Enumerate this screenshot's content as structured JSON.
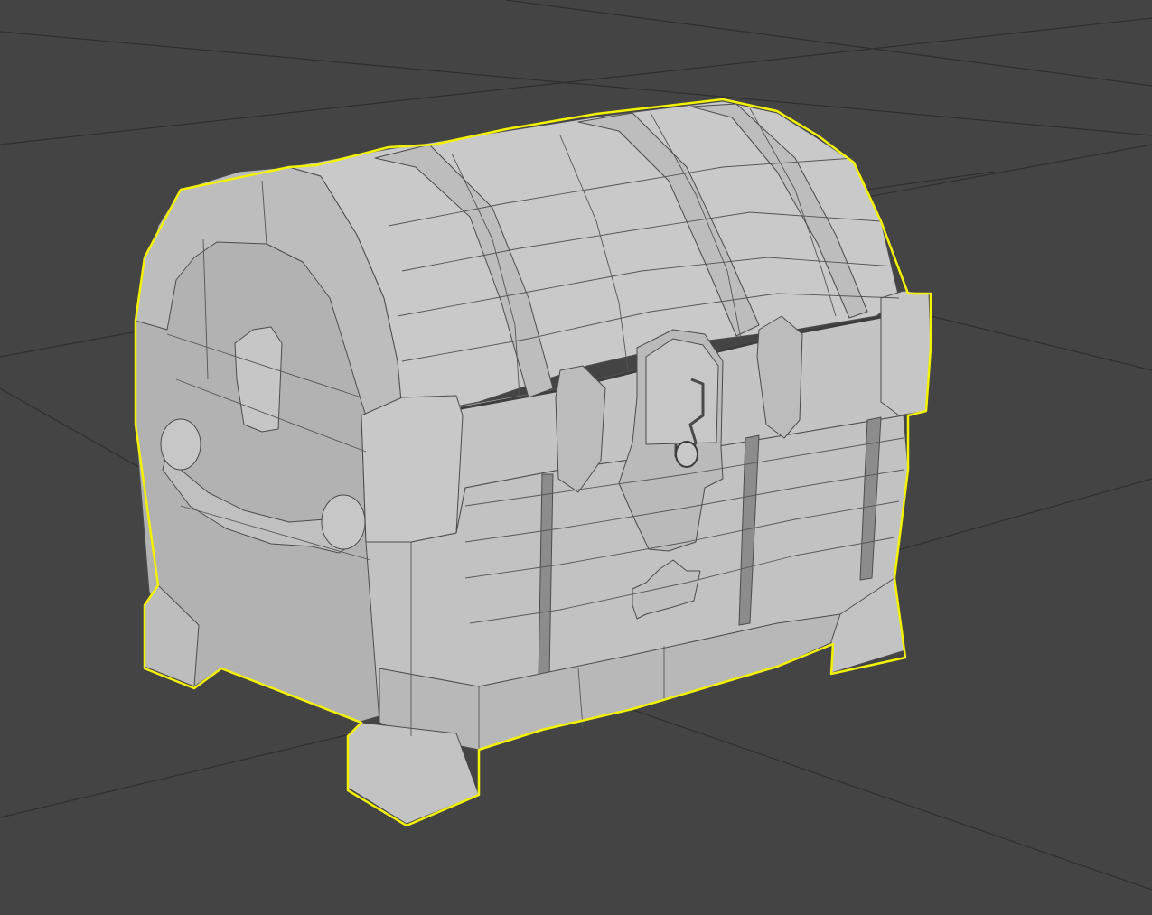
{
  "viewport": {
    "background_color": "#444444",
    "grid_line_color": "#2e2e2e",
    "grid_line_color_dark": "#1a1a1a",
    "selection_outline_color": "#f2f200",
    "model_face_color": "#c4c4c4",
    "model_shadow_color": "#a8a8a8",
    "model_highlight_color": "#d6d6d6",
    "model_edge_color": "#4a4a4a",
    "selected_object": "treasure-chest"
  }
}
